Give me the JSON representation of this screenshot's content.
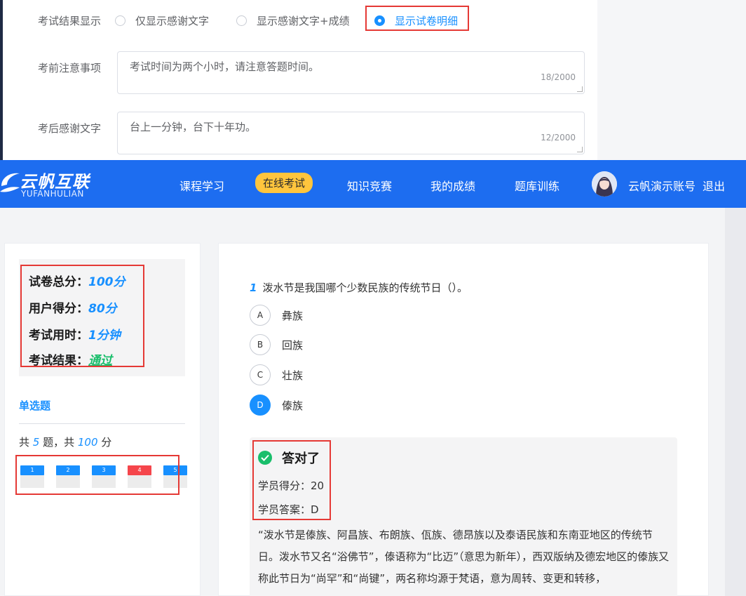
{
  "settings": {
    "result_display": {
      "label": "考试结果显示",
      "options": [
        "仅显示感谢文字",
        "显示感谢文字+成绩",
        "显示试卷明细"
      ],
      "selected_index": 2
    },
    "pre_notice": {
      "label": "考前注意事项",
      "value": "考试时间为两个小时，请注意答题时间。",
      "counter": "18/2000"
    },
    "thanks_text": {
      "label": "考后感谢文字",
      "value": "台上一分钟，台下十年功。",
      "counter": "12/2000"
    }
  },
  "nav": {
    "logo_cn": "云帆互联",
    "logo_en": "YUFANHULIAN",
    "items": [
      "课程学习",
      "在线考试",
      "知识竞赛",
      "我的成绩",
      "题库训练"
    ],
    "active_index": 1,
    "user_name": "云帆演示账号",
    "logout": "退出"
  },
  "sidebar": {
    "total_label": "试卷总分：",
    "total_value": "100分",
    "user_label": "用户得分：",
    "user_value": "80分",
    "time_label": "考试用时：",
    "time_value": "1分钟",
    "result_label": "考试结果：",
    "result_value": "通过",
    "section_title": "单选题",
    "count_prefix": "共 ",
    "count_questions": "5",
    "count_mid": " 题，共 ",
    "count_points": "100",
    "count_suffix": " 分",
    "questions": [
      {
        "num": "1",
        "status": "correct"
      },
      {
        "num": "2",
        "status": "correct"
      },
      {
        "num": "3",
        "status": "correct"
      },
      {
        "num": "4",
        "status": "wrong"
      },
      {
        "num": "5",
        "status": "correct"
      }
    ]
  },
  "question": {
    "number": "1",
    "text": "泼水节是我国哪个少数民族的传统节日（）。",
    "options": [
      {
        "letter": "A",
        "text": "彝族"
      },
      {
        "letter": "B",
        "text": "回族"
      },
      {
        "letter": "C",
        "text": "壮族"
      },
      {
        "letter": "D",
        "text": "傣族"
      }
    ],
    "selected_letter": "D",
    "result_title": "答对了",
    "score_label": "学员得分：",
    "score_value": "20",
    "answer_label": "学员答案：",
    "answer_value": "D",
    "explanation": "“泼水节是傣族、阿昌族、布朗族、佤族、德昂族以及泰语民族和东南亚地区的传统节日。泼水节又名“浴佛节”，傣语称为“比迈”（意思为新年），西双版纳及德宏地区的傣族又称此节日为“尚罕”和“尚键”，两名称均源于梵语，意为周转、变更和转移，"
  },
  "colors": {
    "primary": "#1890ff",
    "nav_bg": "#1d6df0",
    "active_pill": "#ffc53d",
    "pass": "#19be6b",
    "wrong": "#f5454b",
    "highlight": "#e53935"
  }
}
